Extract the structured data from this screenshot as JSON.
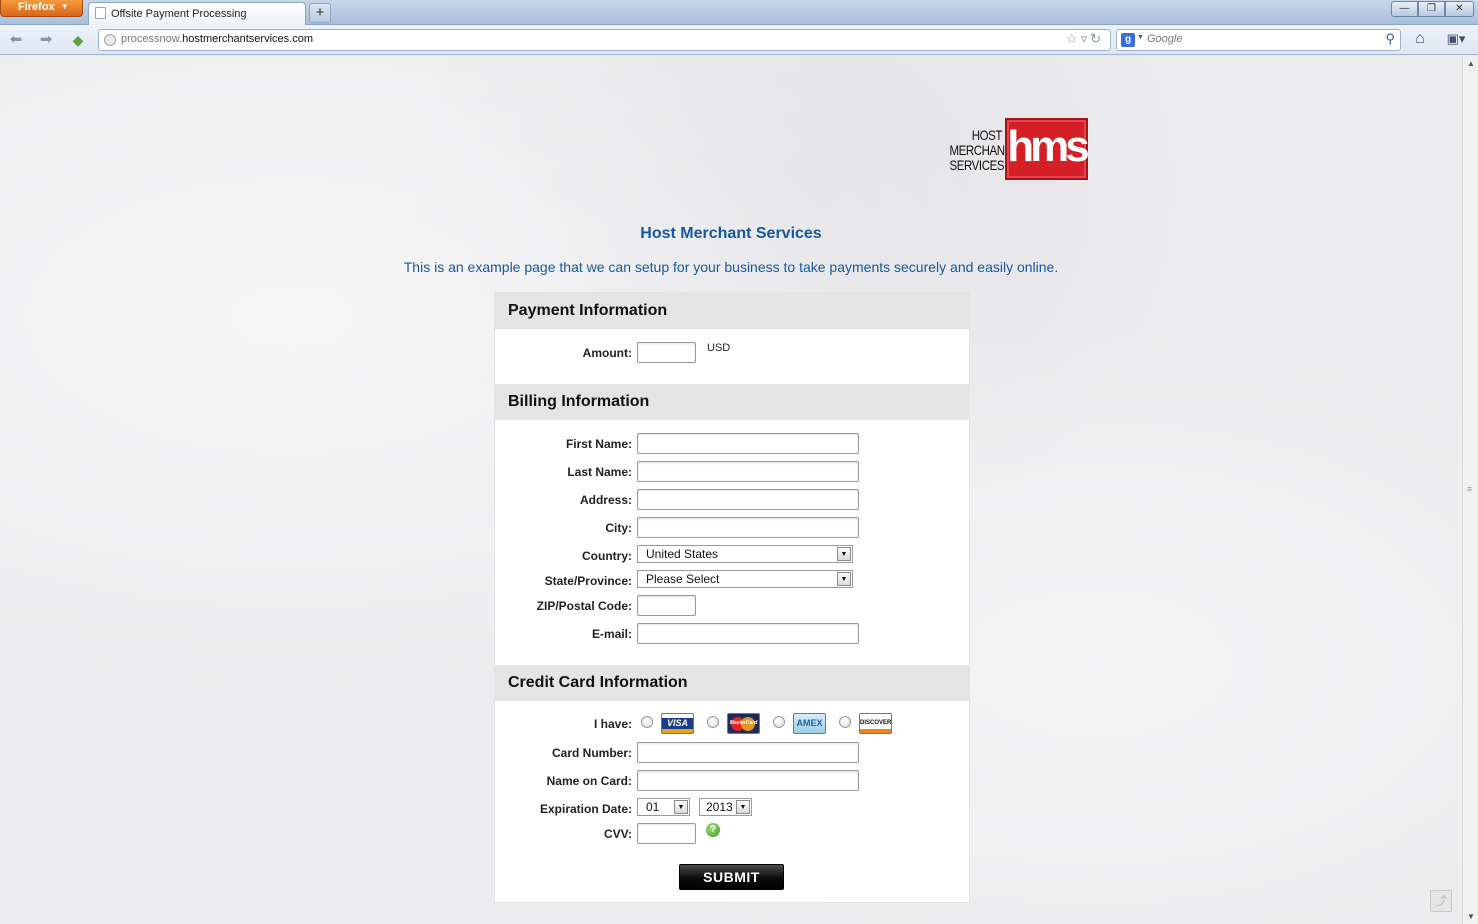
{
  "browser": {
    "menu_label": "Firefox",
    "tab_title": "Offsite Payment Processing",
    "new_tab_label": "+",
    "url_prefix": "processnow.",
    "url_host": "hostmerchantservices.com",
    "search_placeholder": "Google",
    "search_engine_glyph": "g"
  },
  "logo": {
    "text_line1": "HOST",
    "text_line2": "MERCHANT",
    "text_line3": "SERVICES",
    "mark": "hms",
    "mark_color": "#d41f26"
  },
  "page": {
    "title": "Host Merchant Services",
    "intro": "This is an example page that we can setup for your business to take payments securely and easily online."
  },
  "payment": {
    "heading": "Payment Information",
    "amount_label": "Amount:",
    "amount_value": "",
    "currency": "USD"
  },
  "billing": {
    "heading": "Billing Information",
    "first_name_label": "First Name:",
    "last_name_label": "Last Name:",
    "address_label": "Address:",
    "city_label": "City:",
    "country_label": "Country:",
    "country_value": "United States",
    "state_label": "State/Province:",
    "state_value": "Please Select",
    "zip_label": "ZIP/Postal Code:",
    "email_label": "E-mail:"
  },
  "card": {
    "heading": "Credit Card Information",
    "i_have_label": "I have:",
    "visa_text": "VISA",
    "mastercard_text": "MasterCard",
    "amex_text": "AMEX",
    "discover_text": "DISCOVER",
    "number_label": "Card Number:",
    "name_label": "Name on Card:",
    "expiration_label": "Expiration Date:",
    "exp_month": "01",
    "exp_year": "2013",
    "cvv_label": "CVV:",
    "help_glyph": "?"
  },
  "submit_label": "SUBMIT",
  "colors": {
    "accent_text": "#17579c",
    "section_header_bg": "#e4e4e4",
    "submit_bg": "#0c0c0c"
  }
}
